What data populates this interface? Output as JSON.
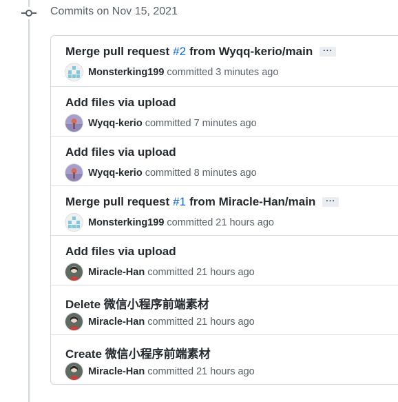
{
  "group": {
    "header": "Commits on Nov 15, 2021"
  },
  "commits": [
    {
      "title": "Merge pull request",
      "pr": "#2",
      "title_tail": "from Wyqq-kerio/main",
      "has_ellipsis": true,
      "author": "Monsterking199",
      "verb": "committed",
      "time": "3 minutes ago",
      "avatar": "identicon"
    },
    {
      "title": "Add files via upload",
      "author": "Wyqq-kerio",
      "verb": "committed",
      "time": "7 minutes ago",
      "avatar": "purple"
    },
    {
      "title": "Add files via upload",
      "author": "Wyqq-kerio",
      "verb": "committed",
      "time": "8 minutes ago",
      "avatar": "purple"
    },
    {
      "title": "Merge pull request",
      "pr": "#1",
      "title_tail": "from Miracle-Han/main",
      "has_ellipsis": true,
      "author": "Monsterking199",
      "verb": "committed",
      "time": "21 hours ago",
      "avatar": "identicon"
    },
    {
      "title": "Add files via upload",
      "author": "Miracle-Han",
      "verb": "committed",
      "time": "21 hours ago",
      "avatar": "photo"
    },
    {
      "title": "Delete 微信小程序前端素材",
      "author": "Miracle-Han",
      "verb": "committed",
      "time": "21 hours ago",
      "avatar": "photo"
    },
    {
      "title": "Create 微信小程序前端素材",
      "author": "Miracle-Han",
      "verb": "committed",
      "time": "21 hours ago",
      "avatar": "photo"
    }
  ],
  "ellipsis_label": "···",
  "colors": {
    "link": "#0969da",
    "muted": "#57606a",
    "border": "#d0d7de"
  },
  "icons": {
    "commit_node": "git-commit-icon",
    "expand": "ellipsis-icon"
  }
}
